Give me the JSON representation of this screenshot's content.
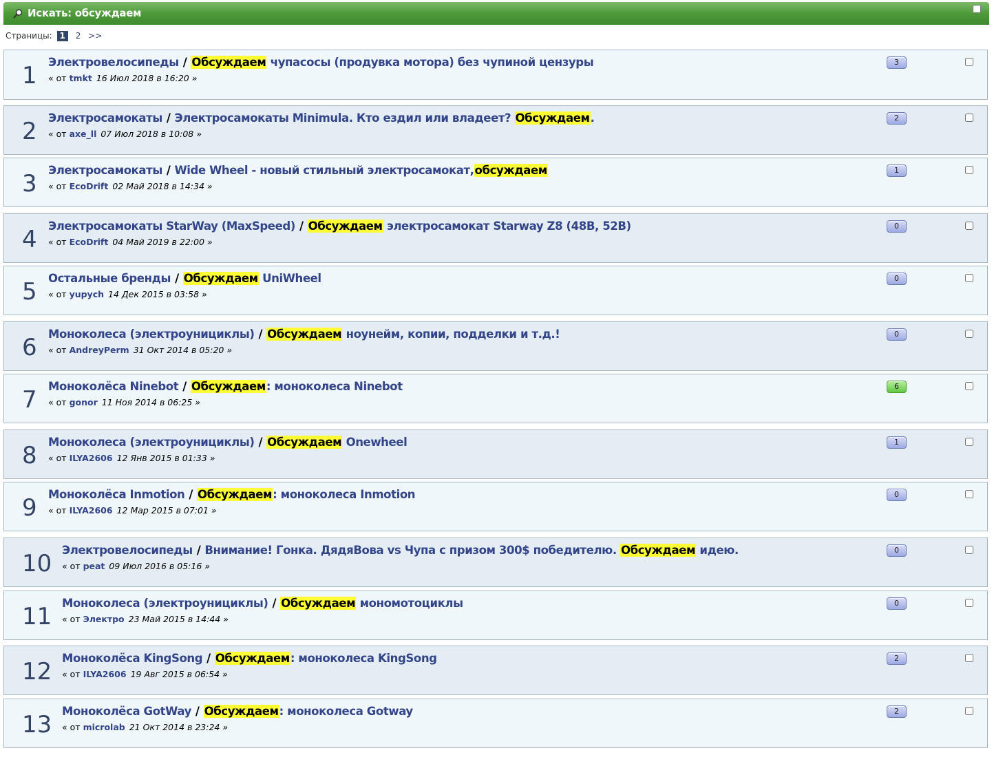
{
  "header": {
    "title": "Искать: обсуждаем"
  },
  "pager": {
    "label": "Страницы:",
    "current": "1",
    "next_page": "2",
    "next_arrow": ">>"
  },
  "results": [
    {
      "num": "1",
      "board": "Электровелосипеды",
      "pre": "",
      "hl": "Обсуждаем",
      "post": " чупасосы (продувка мотора) без чупиной цензуры",
      "by": "« от",
      "author": "tmkt",
      "date": "16 Июл 2018 в 16:20 »",
      "replies": "3",
      "hot": false
    },
    {
      "num": "2",
      "board": "Электросамокаты",
      "pre": "Электросамокаты Minimula. Кто ездил или владеет? ",
      "hl": "Обсуждаем",
      "post": ".",
      "by": "« от",
      "author": "axe_ll",
      "date": "07 Июл 2018 в 10:08 »",
      "replies": "2",
      "hot": false
    },
    {
      "num": "3",
      "board": "Электросамокаты",
      "pre": "Wide Wheel - новый стильный электросамокат,",
      "hl": "обсуждаем",
      "post": "",
      "by": "« от",
      "author": "EcoDrift",
      "date": "02 Май 2018 в 14:34 »",
      "replies": "1",
      "hot": false
    },
    {
      "num": "4",
      "board": "Электросамокаты StarWay (MaxSpeed)",
      "pre": "",
      "hl": "Обсуждаем",
      "post": " электросамокат Starway Z8 (48В, 52В)",
      "by": "« от",
      "author": "EcoDrift",
      "date": "04 Май 2019 в 22:00 »",
      "replies": "0",
      "hot": false
    },
    {
      "num": "5",
      "board": "Остальные бренды",
      "pre": "",
      "hl": "Обсуждаем",
      "post": " UniWheel",
      "by": "« от",
      "author": "yupych",
      "date": "14 Дек 2015 в 03:58 »",
      "replies": "0",
      "hot": false
    },
    {
      "num": "6",
      "board": "Моноколеса (электроунициклы)",
      "pre": "",
      "hl": "Обсуждаем",
      "post": " ноунейм, копии, подделки и т.д.!",
      "by": "« от",
      "author": "AndreyPerm",
      "date": "31 Окт 2014 в 05:20 »",
      "replies": "0",
      "hot": false
    },
    {
      "num": "7",
      "board": "Моноколёса Ninebot",
      "pre": "",
      "hl": "Обсуждаем",
      "post": ": моноколеса Ninebot",
      "by": "« от",
      "author": "gonor",
      "date": "11 Ноя 2014 в 06:25 »",
      "replies": "6",
      "hot": true
    },
    {
      "num": "8",
      "board": "Моноколеса (электроунициклы)",
      "pre": "",
      "hl": "Обсуждаем",
      "post": " Onewheel",
      "by": "« от",
      "author": "ILYA2606",
      "date": "12 Янв 2015 в 01:33 »",
      "replies": "1",
      "hot": false
    },
    {
      "num": "9",
      "board": "Моноколёса Inmotion",
      "pre": "",
      "hl": "Обсуждаем",
      "post": ": моноколеса Inmotion",
      "by": "« от",
      "author": "ILYA2606",
      "date": "12 Мар 2015 в 07:01 »",
      "replies": "0",
      "hot": false
    },
    {
      "num": "10",
      "board": "Электровелосипеды",
      "pre": "Внимание! Гонка. ДядяВова vs Чупа с призом 300$ победителю. ",
      "hl": "Обсуждаем",
      "post": " идею.",
      "by": "« от",
      "author": "peat",
      "date": "09 Июл 2016 в 05:16 »",
      "replies": "0",
      "hot": false
    },
    {
      "num": "11",
      "board": "Моноколеса (электроунициклы)",
      "pre": "",
      "hl": "Обсуждаем",
      "post": " мономотоциклы",
      "by": "« от",
      "author": "Электро",
      "date": "23 Май 2015 в 14:44 »",
      "replies": "0",
      "hot": false
    },
    {
      "num": "12",
      "board": "Моноколёса KingSong",
      "pre": "",
      "hl": "Обсуждаем",
      "post": ": моноколеса KingSong",
      "by": "« от",
      "author": "ILYA2606",
      "date": "19 Авг 2015 в 06:54 »",
      "replies": "2",
      "hot": false
    },
    {
      "num": "13",
      "board": "Моноколёса GotWay",
      "pre": "",
      "hl": "Обсуждаем",
      "post": ": моноколеса Gotway",
      "by": "« от",
      "author": "microlab",
      "date": "21 Окт 2014 в 23:24 »",
      "replies": "2",
      "hot": false
    }
  ],
  "colors": {
    "title_bar": "#4f9a3a",
    "highlight": "#ffff33",
    "badge_default": "#9da9e2",
    "badge_hot": "#62c844",
    "link": "#334488"
  }
}
